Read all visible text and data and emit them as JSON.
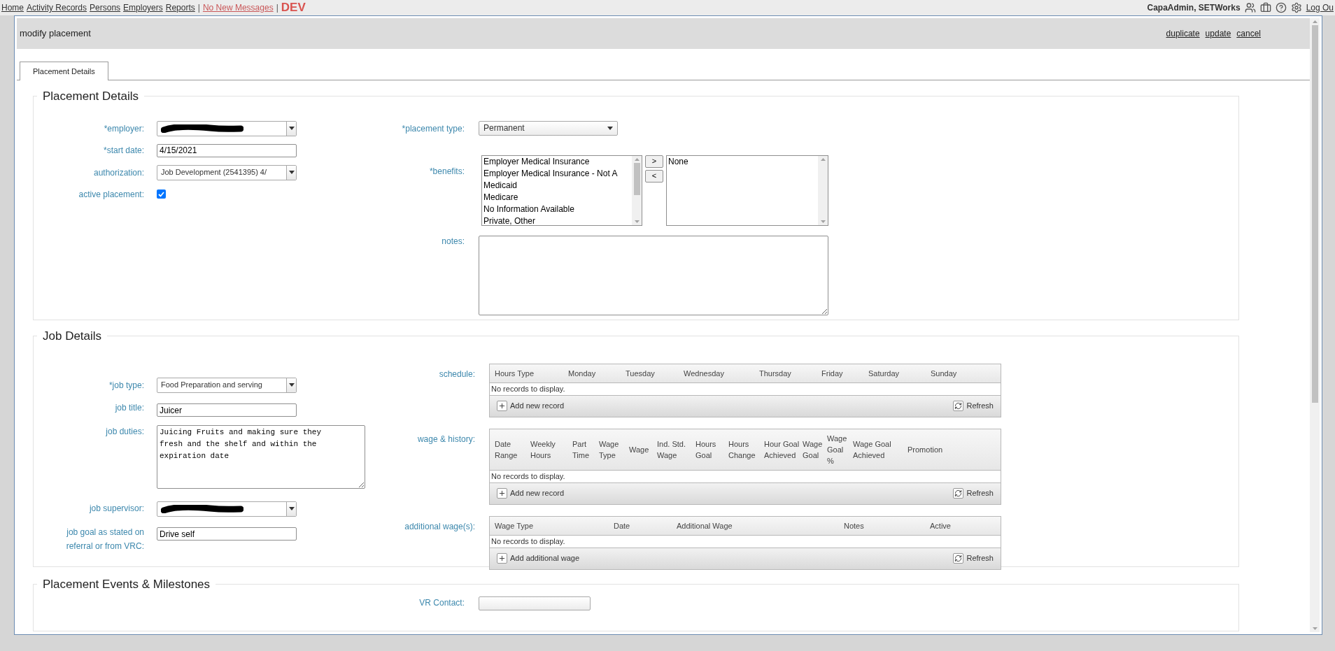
{
  "top_nav": {
    "links": [
      "Home",
      "Activity Records",
      "Persons",
      "Employers",
      "Reports"
    ],
    "separator": "|",
    "messages": "No New Messages",
    "env": "DEV",
    "user": "CapaAdmin, SETWorks",
    "logout": "Log Ou"
  },
  "dialog": {
    "title": "modify placement",
    "actions": [
      "duplicate",
      "update",
      "cancel"
    ],
    "tabs": [
      {
        "label": "Placement Details",
        "selected": true
      }
    ],
    "placement": {
      "legend": "Placement Details",
      "employer": {
        "label": "*employer:",
        "redacted": true
      },
      "start_date": {
        "label": "*start date:",
        "value": "4/15/2021"
      },
      "authorization": {
        "label": "authorization:",
        "value": "Job Development (2541395) 4/"
      },
      "active": {
        "label": "active placement:",
        "checked": true
      },
      "placement_type": {
        "label": "*placement type:",
        "value": "Permanent"
      },
      "benefits": {
        "label": "*benefits:",
        "available": [
          "Employer Medical Insurance",
          "Employer Medical Insurance - Not A",
          "Medicaid",
          "Medicare",
          "No Information Available",
          "Private, Other"
        ],
        "chosen": [
          "None"
        ],
        "add": ">",
        "remove": "<"
      },
      "notes": {
        "label": "notes:"
      }
    },
    "job": {
      "legend": "Job Details",
      "job_type": {
        "label": "*job type:",
        "value": "Food Preparation and serving"
      },
      "job_title": {
        "label": "job title:",
        "value": "Juicer"
      },
      "job_duties": {
        "label": "job duties:",
        "value": "Juicing Fruits and making sure they\nfresh and the shelf and within the\nexpiration date"
      },
      "job_supervisor": {
        "label": "job supervisor:",
        "redacted": true
      },
      "job_goal": {
        "label": "job goal as stated on referral or from VRC:",
        "value": "Drive self"
      },
      "grids": [
        {
          "label": "schedule:",
          "columns": [
            "Hours Type",
            "Monday",
            "Tuesday",
            "Wednesday",
            "Thursday",
            "Friday",
            "Saturday",
            "Sunday"
          ],
          "empty": "No records to display.",
          "add": "Add new record",
          "refresh": "Refresh"
        },
        {
          "label": "wage & history:",
          "columns": [
            "Date Range",
            "Weekly Hours",
            "Part Time",
            "Wage Type",
            "Wage",
            "Ind. Std. Wage",
            "Hours Goal",
            "Hours Change",
            "Hour Goal Achieved",
            "Wage Goal",
            "Wage Goal %",
            "Wage Goal Achieved",
            "Promotion"
          ],
          "empty": "No records to display.",
          "add": "Add new record",
          "refresh": "Refresh"
        },
        {
          "label": "additional wage(s):",
          "columns": [
            "Wage Type",
            "Date",
            "Additional Wage",
            "Notes",
            "Active"
          ],
          "empty": "No records to display.",
          "add": "Add additional wage",
          "refresh": "Refresh"
        }
      ]
    },
    "events": {
      "legend": "Placement Events & Milestones",
      "vr_contact": {
        "label": "VR Contact:"
      }
    }
  }
}
